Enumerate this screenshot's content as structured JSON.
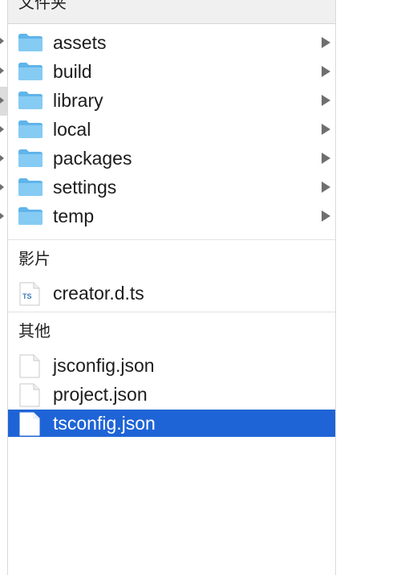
{
  "header": {
    "title": "文件夹"
  },
  "folders": [
    {
      "label": "assets"
    },
    {
      "label": "build"
    },
    {
      "label": "library"
    },
    {
      "label": "local"
    },
    {
      "label": "packages"
    },
    {
      "label": "settings"
    },
    {
      "label": "temp"
    }
  ],
  "movies": {
    "title": "影片",
    "items": [
      {
        "label": "creator.d.ts",
        "badge": "TS"
      }
    ]
  },
  "other": {
    "title": "其他",
    "items": [
      {
        "label": "jsconfig.json"
      },
      {
        "label": "project.json"
      },
      {
        "label": "tsconfig.json",
        "selected": true
      }
    ]
  },
  "colors": {
    "selection": "#1f64d6",
    "folder": "#7ec8f2",
    "chevron": "#6f6f6f"
  },
  "icons": {
    "folder": "folder-icon",
    "file": "document-icon",
    "ts_file": "typescript-file-icon",
    "disclosure": "chevron-right-icon"
  }
}
